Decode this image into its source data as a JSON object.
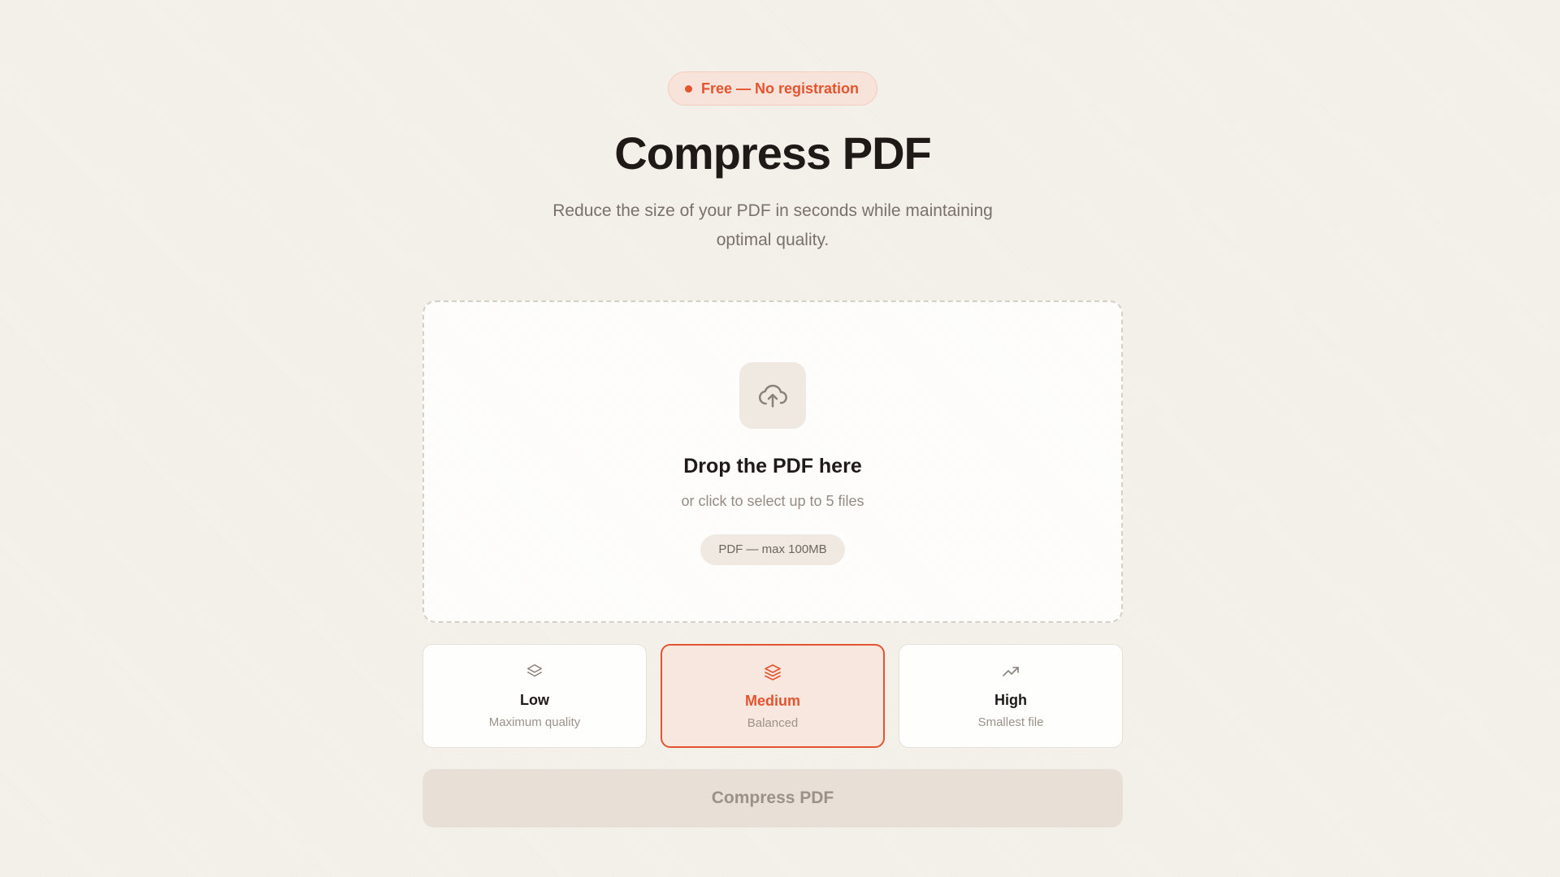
{
  "badge": {
    "label": "Free — No registration",
    "color": "#e4542f"
  },
  "header": {
    "title": "Compress PDF",
    "subtitle": "Reduce the size of your PDF in seconds while maintaining optimal quality."
  },
  "dropzone": {
    "icon": "cloud-upload-icon",
    "title": "Drop the PDF here",
    "subtitle": "or click to select up to 5 files",
    "hint": "PDF — max 100MB"
  },
  "compression_levels": [
    {
      "icon": "layers-icon",
      "name": "Low",
      "description": "Maximum quality",
      "selected": false
    },
    {
      "icon": "layers-icon",
      "name": "Medium",
      "description": "Balanced",
      "selected": true
    },
    {
      "icon": "trending-up-icon",
      "name": "High",
      "description": "Smallest file",
      "selected": false
    }
  ],
  "action": {
    "compress_label": "Compress PDF",
    "disabled": true
  },
  "colors": {
    "accent": "#e4542f",
    "background": "#f4f0ea",
    "text": "#1f1a17"
  }
}
